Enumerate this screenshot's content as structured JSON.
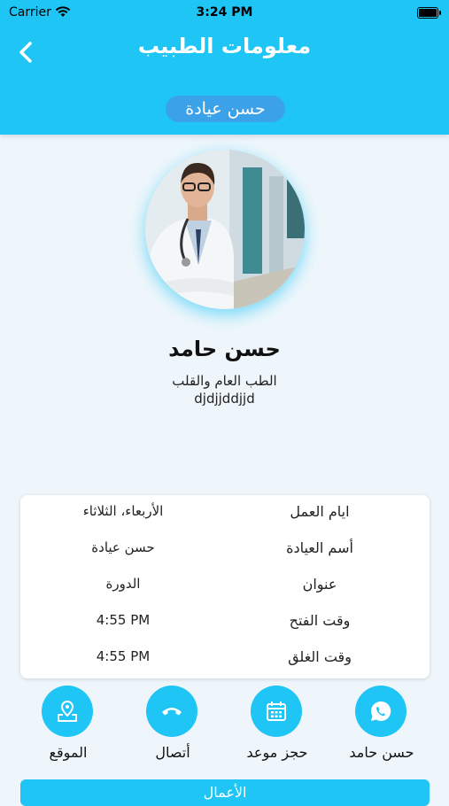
{
  "status_bar": {
    "carrier": "Carrier",
    "time": "3:24 PM"
  },
  "header": {
    "title": "معلومات الطبيب",
    "clinic_pill": "حسن عيادة"
  },
  "doctor": {
    "name": "حسن حامد",
    "specialty": "الطب العام والقلب",
    "subtitle": "djdjjddjjd"
  },
  "info": [
    {
      "label": "ايام العمل",
      "value": "الأربعاء، الثلاثاء"
    },
    {
      "label": "أسم العيادة",
      "value": "حسن عيادة"
    },
    {
      "label": "عنوان",
      "value": "الدورة"
    },
    {
      "label": "وقت الفتح",
      "value": "4:55 PM"
    },
    {
      "label": "وقت الغلق",
      "value": "4:55 PM"
    }
  ],
  "actions": [
    {
      "label": "حسن حامد",
      "icon": "whatsapp-icon"
    },
    {
      "label": "حجز موعد",
      "icon": "calendar-icon"
    },
    {
      "label": "أتصال",
      "icon": "phone-icon"
    },
    {
      "label": "الموقع",
      "icon": "location-icon"
    }
  ],
  "bottom_button": "الأعمال",
  "colors": {
    "accent": "#1ec5f5",
    "pill": "#3ba2ea"
  }
}
